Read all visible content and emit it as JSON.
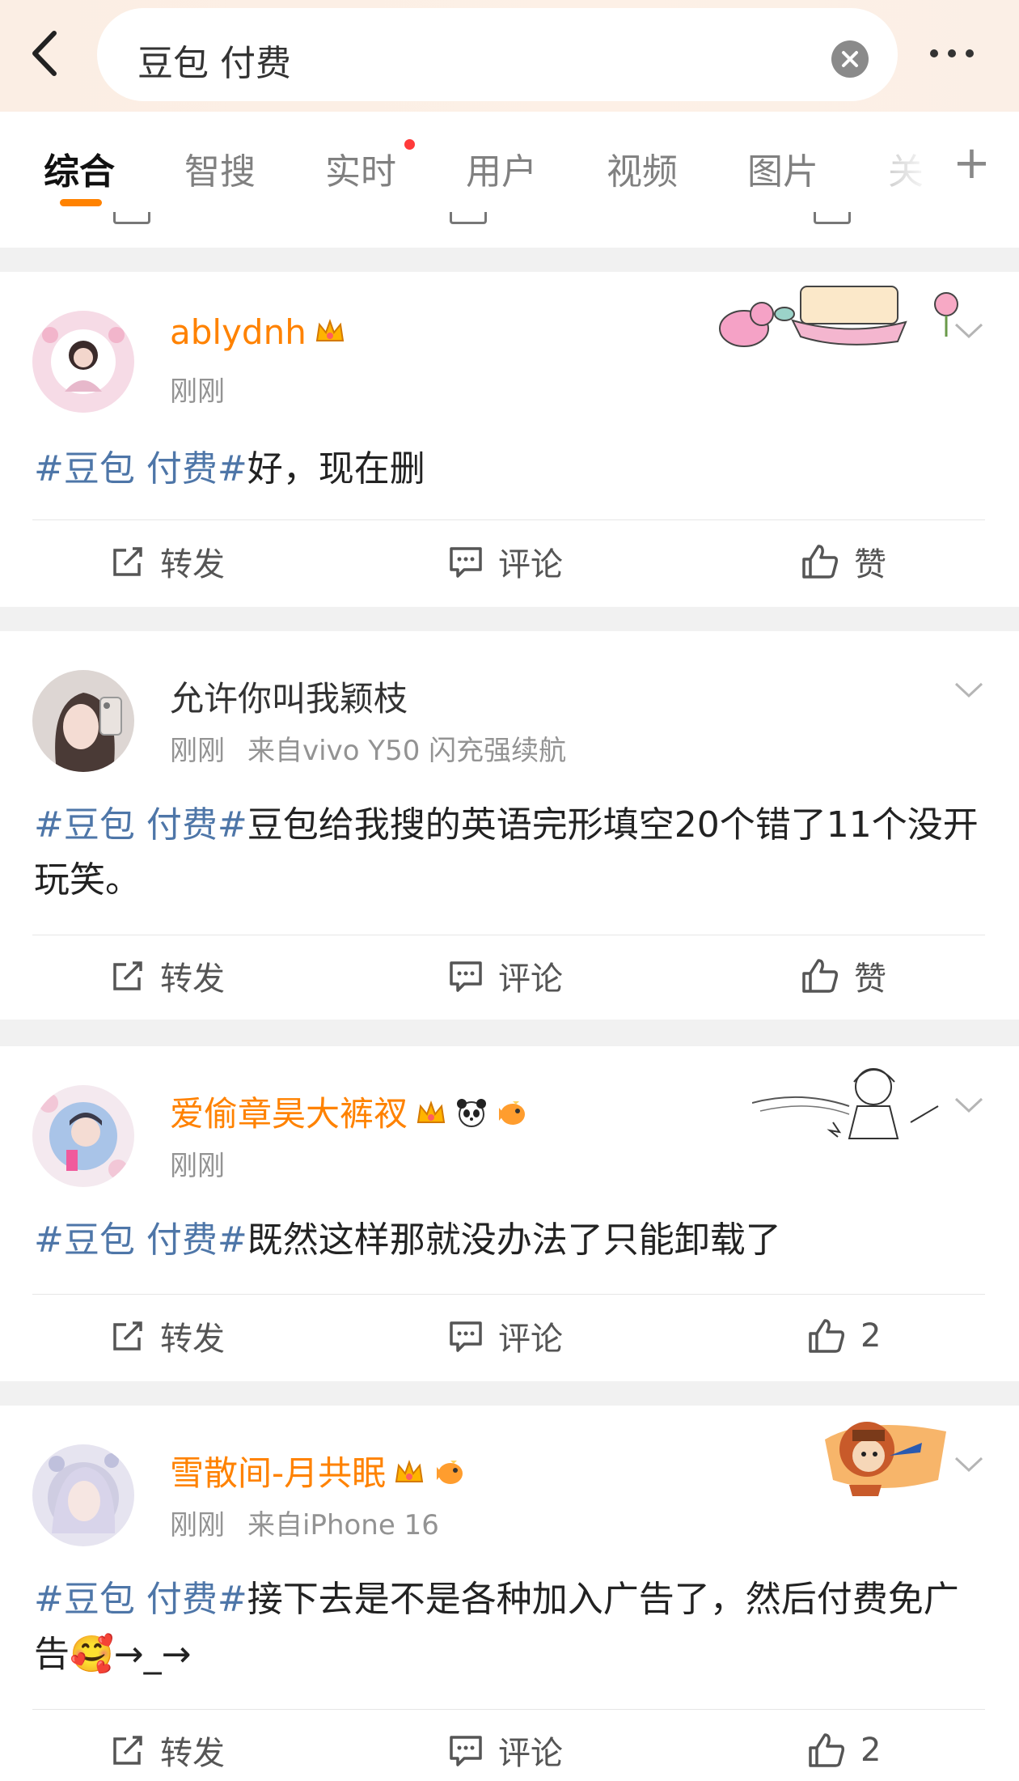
{
  "search": {
    "query": "豆包 付费"
  },
  "tabs": [
    {
      "label": "综合"
    },
    {
      "label": "智搜"
    },
    {
      "label": "实时"
    },
    {
      "label": "用户"
    },
    {
      "label": "视频"
    },
    {
      "label": "图片"
    },
    {
      "label": "关"
    }
  ],
  "colors": {
    "accent": "#ff8200",
    "hashtag": "#4e76a8",
    "vip_name": "#ff8200",
    "new_dot": "#ff3a3a"
  },
  "posts": [
    {
      "username": "ablydnh",
      "time": "刚刚",
      "source": "",
      "hashtag": "#豆包 付费#",
      "text": "好，现在删",
      "actions": {
        "repost": "转发",
        "comment": "评论",
        "like": "赞"
      }
    },
    {
      "username": "允许你叫我颖枝",
      "time": "刚刚",
      "source": "来自vivo Y50 闪充强续航",
      "hashtag": "#豆包 付费#",
      "text": "豆包给我搜的英语完形填空20个错了11个没开玩笑。",
      "actions": {
        "repost": "转发",
        "comment": "评论",
        "like": "赞"
      }
    },
    {
      "username": "爱偷章昊大裤衩",
      "time": "刚刚",
      "source": "",
      "hashtag": "#豆包 付费#",
      "text": "既然这样那就没办法了只能卸载了",
      "actions": {
        "repost": "转发",
        "comment": "评论",
        "like": "2"
      }
    },
    {
      "username": "雪散间-月共眠",
      "time": "刚刚",
      "source": "来自iPhone 16",
      "hashtag": "#豆包 付费#",
      "text": "接下去是不是各种加入广告了，然后付费免广告🥰→_→",
      "actions": {
        "repost": "转发",
        "comment": "评论",
        "like": "2"
      }
    }
  ]
}
